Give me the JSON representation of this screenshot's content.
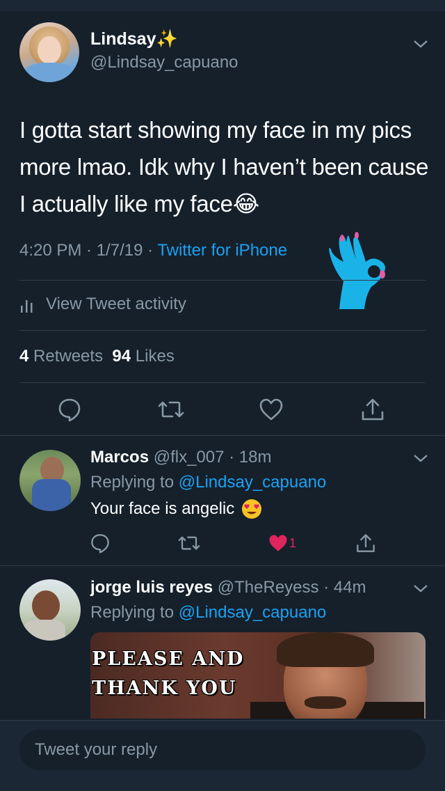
{
  "main_tweet": {
    "name": "Lindsay",
    "name_emoji": "✨",
    "handle": "@Lindsay_capuano",
    "text": "I gotta start showing my face in my pics more lmao. Idk why I haven’t been cause I actually like my face😂",
    "time": "4:20 PM · 1/7/19 · ",
    "source": "Twitter for iPhone",
    "activity_label": "View Tweet activity",
    "retweets_count": "4",
    "retweets_label": "Retweets",
    "likes_count": "94",
    "likes_label": "Likes"
  },
  "replies": [
    {
      "name": "Marcos",
      "handle_time": "@flx_007 · 18m",
      "replying_prefix": "Replying to ",
      "replying_to": "@Lindsay_capuano",
      "text": "Your face is angelic",
      "like_count": "1"
    },
    {
      "name": "jorge luis reyes",
      "handle_time": "@TheReyess · 44m",
      "replying_prefix": "Replying to ",
      "replying_to": "@Lindsay_capuano",
      "gif_caption_line1": "PLEASE AND",
      "gif_caption_line2": "THANK YOU"
    }
  ],
  "composer": {
    "placeholder": "Tweet your reply"
  },
  "colors": {
    "background": "#15202b",
    "accent": "#1da1f2",
    "muted": "#8899a6",
    "like": "#e0245e"
  }
}
